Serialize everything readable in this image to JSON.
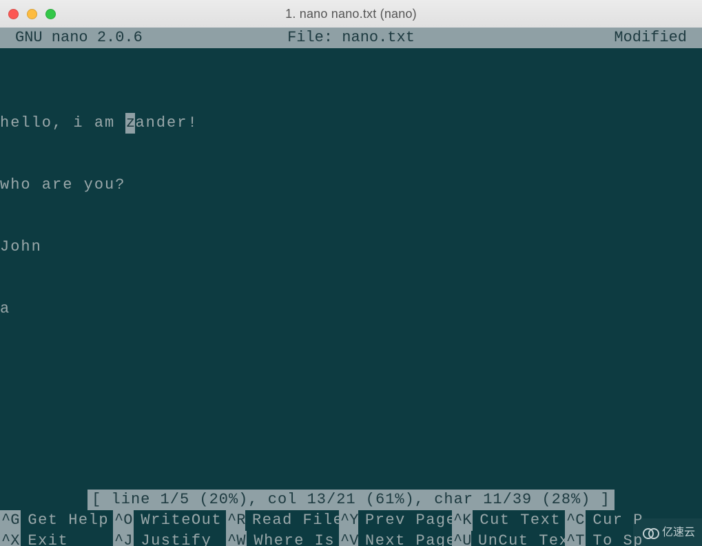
{
  "window": {
    "title": "1. nano nano.txt (nano)"
  },
  "header": {
    "version": "GNU nano 2.0.6",
    "file_label": "File: nano.txt",
    "modified": "Modified"
  },
  "editor": {
    "line1_pre": "hello, i am ",
    "line1_cursor": "z",
    "line1_post": "ander!",
    "line2": "who are you?",
    "line3": "John",
    "line4": "a"
  },
  "status": {
    "text": "[ line 1/5 (20%), col 13/21 (61%), char 11/39 (28%) ]"
  },
  "help": {
    "row1": [
      {
        "key": "^G",
        "label": "Get Help"
      },
      {
        "key": "^O",
        "label": "WriteOut"
      },
      {
        "key": "^R",
        "label": "Read File"
      },
      {
        "key": "^Y",
        "label": "Prev Page"
      },
      {
        "key": "^K",
        "label": "Cut Text"
      },
      {
        "key": "^C",
        "label": "Cur P"
      }
    ],
    "row2": [
      {
        "key": "^X",
        "label": "Exit"
      },
      {
        "key": "^J",
        "label": "Justify"
      },
      {
        "key": "^W",
        "label": "Where Is"
      },
      {
        "key": "^V",
        "label": "Next Page"
      },
      {
        "key": "^U",
        "label": "UnCut Text"
      },
      {
        "key": "^T",
        "label": "To Sp"
      }
    ]
  },
  "watermark": {
    "text": "亿速云"
  }
}
